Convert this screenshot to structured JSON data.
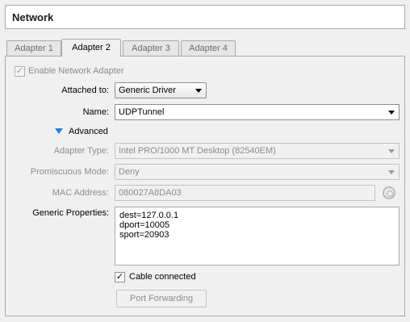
{
  "header": {
    "title": "Network"
  },
  "tabs": [
    "Adapter 1",
    "Adapter 2",
    "Adapter 3",
    "Adapter 4"
  ],
  "active_tab_index": 1,
  "form": {
    "enable_adapter": {
      "label": "Enable Network Adapter",
      "checked": true,
      "check_mark": "✓"
    },
    "attached_to": {
      "label": "Attached to:",
      "value": "Generic Driver"
    },
    "name": {
      "label": "Name:",
      "value": "UDPTunnel"
    },
    "advanced": {
      "label": "Advanced"
    },
    "adapter_type": {
      "label": "Adapter Type:",
      "value": "Intel PRO/1000 MT Desktop (82540EM)"
    },
    "promiscuous_mode": {
      "label": "Promiscuous Mode:",
      "value": "Deny"
    },
    "mac_address": {
      "label": "MAC Address:",
      "value": "080027A8DA03"
    },
    "generic_properties": {
      "label": "Generic Properties:",
      "lines": [
        "dest=127.0.0.1",
        "dport=10005",
        "sport=20903"
      ]
    },
    "cable_connected": {
      "label": "Cable connected",
      "checked": true,
      "check_mark": "✓"
    },
    "port_forwarding": {
      "label": "Port Forwarding"
    }
  },
  "colors": {
    "accent_triangle": "#2a7fd4",
    "border": "#a9a9a9",
    "disabled_text": "#8c8c8c"
  }
}
